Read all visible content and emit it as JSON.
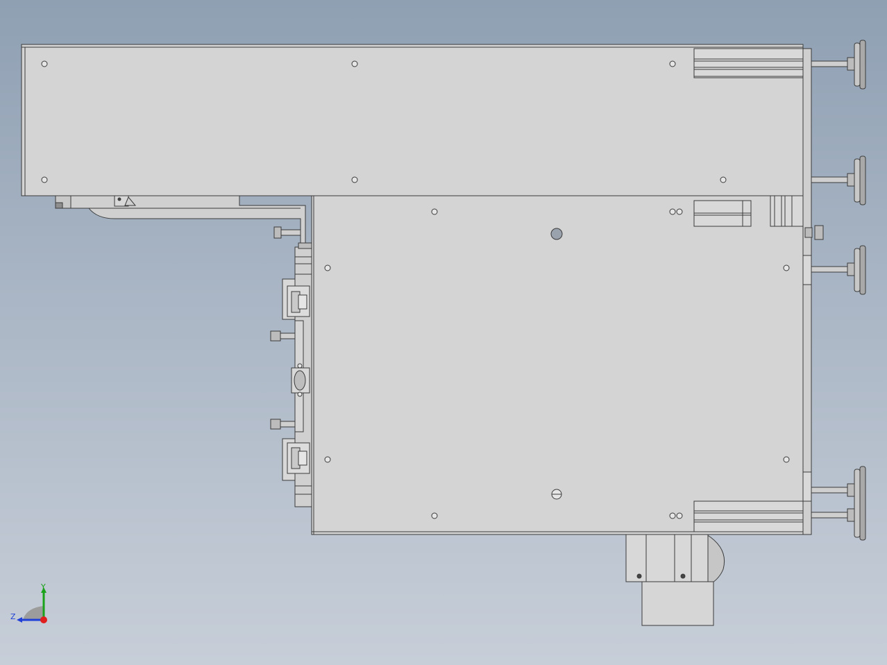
{
  "view": {
    "background_top": "#8fa0b3",
    "background_bottom": "#c7ced8",
    "part_fill": "#d4d4d4",
    "part_edge": "#3a3a3a"
  },
  "triad": {
    "x_label": "",
    "y_label": "Y",
    "z_label": "Z",
    "y_color": "#1aa31a",
    "z_color": "#1f3fd6",
    "origin_color": "#e01e1e"
  }
}
